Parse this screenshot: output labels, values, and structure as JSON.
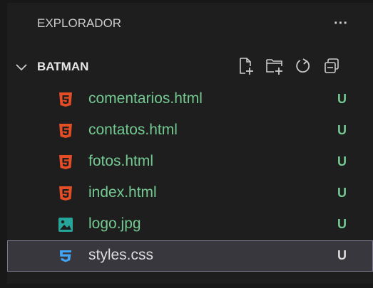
{
  "explorer": {
    "title": "EXPLORADOR",
    "more_label": "···"
  },
  "folder": {
    "name": "BATMAN",
    "actions": [
      "new-file-icon",
      "new-folder-icon",
      "refresh-icon",
      "collapse-all-icon"
    ]
  },
  "files": [
    {
      "name": "comentarios.html",
      "status": "U",
      "icon": "html5-icon",
      "icon_color": "#e44d26"
    },
    {
      "name": "contatos.html",
      "status": "U",
      "icon": "html5-icon",
      "icon_color": "#e44d26"
    },
    {
      "name": "fotos.html",
      "status": "U",
      "icon": "html5-icon",
      "icon_color": "#e44d26"
    },
    {
      "name": "index.html",
      "status": "U",
      "icon": "html5-icon",
      "icon_color": "#e44d26"
    },
    {
      "name": "logo.jpg",
      "status": "U",
      "icon": "image-file-icon",
      "icon_color": "#26a69a"
    },
    {
      "name": "styles.css",
      "status": "U",
      "icon": "css3-icon",
      "icon_color": "#42a5f5",
      "selected": true
    }
  ],
  "colors": {
    "untracked_text": "#73c991",
    "selected_bg": "#37373d",
    "panel_bg": "#1e1e1e"
  }
}
